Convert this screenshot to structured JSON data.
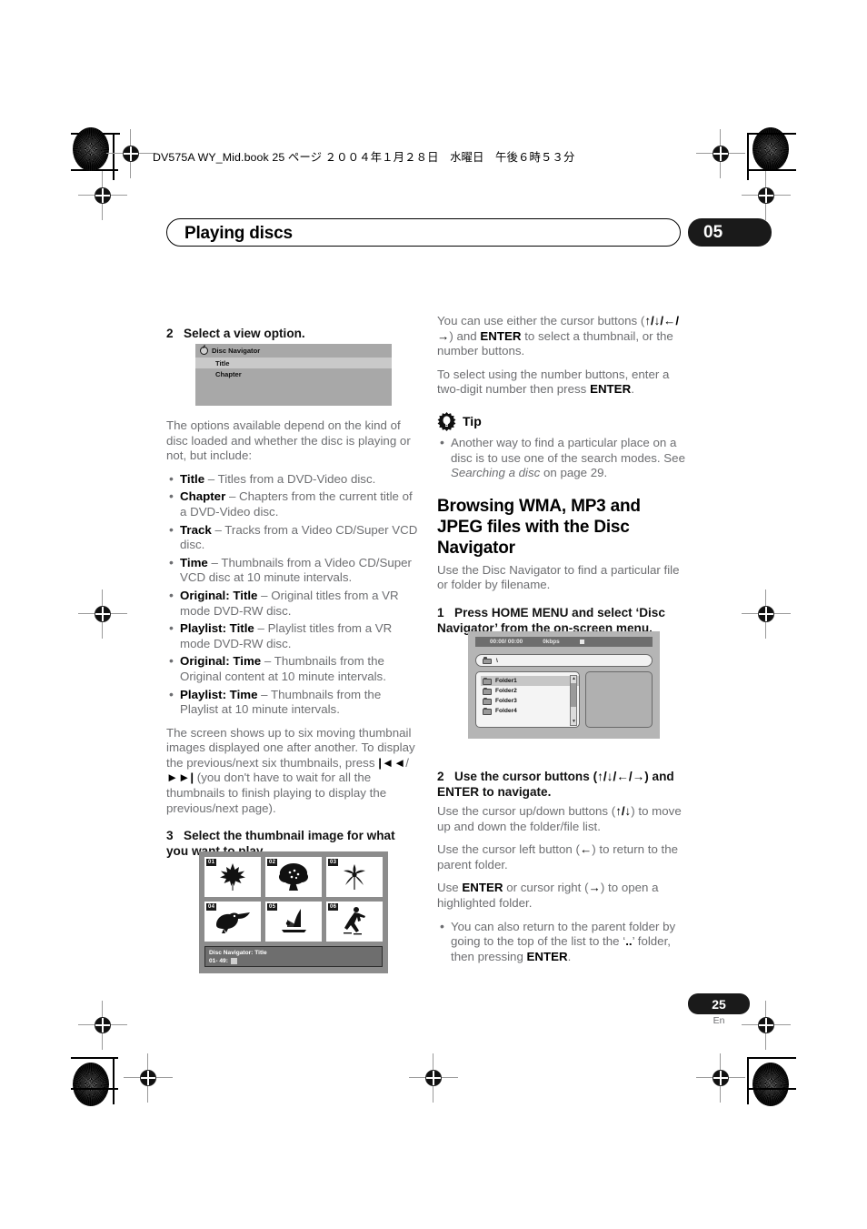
{
  "print_header": {
    "text": "DV575A WY_Mid.book  25 ページ  ２００４年１月２８日　水曜日　午後６時５３分"
  },
  "chapter": {
    "title": "Playing discs",
    "number": "05"
  },
  "left_column": {
    "step2": {
      "num": "2",
      "text": "Select a view option."
    },
    "fig_menu": {
      "header": "Disc Navigator",
      "rows": [
        "Title",
        "Chapter"
      ],
      "selected_index": 0
    },
    "intro_para": "The options available depend on the kind of disc loaded and whether the disc is playing or not, but include:",
    "bullets": [
      {
        "term": "Title",
        "desc": " – Titles from a DVD-Video disc."
      },
      {
        "term": "Chapter",
        "desc": " – Chapters from the current title of a DVD-Video disc."
      },
      {
        "term": "Track",
        "desc": " – Tracks from a Video CD/Super VCD disc."
      },
      {
        "term": "Time",
        "desc": " – Thumbnails from a Video CD/Super VCD disc at 10 minute intervals."
      },
      {
        "term": "Original: Title",
        "desc": " – Original titles from a VR mode DVD-RW disc."
      },
      {
        "term": "Playlist: Title",
        "desc": " – Playlist titles from a VR mode DVD-RW disc."
      },
      {
        "term": "Original: Time",
        "desc": " – Thumbnails from the Original content at 10 minute intervals."
      },
      {
        "term": "Playlist: Time",
        "desc": " – Thumbnails from the Playlist at 10 minute intervals."
      }
    ],
    "thumbs_para_a": "The screen shows up to six moving thumbnail images displayed one after another. To display the previous/next six thumbnails, press ",
    "thumbs_para_prev_glyph": "|◄◄",
    "thumbs_para_slash": "/",
    "thumbs_para_next_glyph": "►►|",
    "thumbs_para_b": " (you don't have to wait for all the thumbnails to finish playing to display the previous/next page).",
    "step3": {
      "num": "3",
      "text": "Select the thumbnail image for what you want to play."
    },
    "fig_thumbs": {
      "items": [
        {
          "badge": "01",
          "icon": "maple-leaf-icon"
        },
        {
          "badge": "02",
          "icon": "tree-icon"
        },
        {
          "badge": "03",
          "icon": "flower-icon"
        },
        {
          "badge": "04",
          "icon": "toucan-icon"
        },
        {
          "badge": "05",
          "icon": "windsurfer-icon"
        },
        {
          "badge": "06",
          "icon": "skater-icon"
        }
      ],
      "status_line1": "Disc Navigator: Title",
      "status_line2": "01- 49:"
    }
  },
  "right_column": {
    "cursor_para_a": "You can use either the cursor buttons (",
    "cursor_glyphs_1": "↑/↓/",
    "cursor_glyphs_2": "←/→",
    "cursor_para_b": ") and ",
    "enter_label": "ENTER",
    "cursor_para_c": " to select a thumbnail, or the number buttons.",
    "number_para_a": "To select using the number buttons, enter a two-digit number then press ",
    "number_para_b": ".",
    "tip": {
      "icon": "gear-lightbulb-icon",
      "title": "Tip",
      "bullet_a": "Another way to find a particular place on a disc is to use one of the search modes. See ",
      "bullet_italic": "Searching a disc",
      "bullet_b": " on page 29."
    },
    "section_heading": "Browsing WMA, MP3 and JPEG files with the Disc Navigator",
    "section_intro": "Use the Disc Navigator to find a particular file or folder by filename.",
    "step1": {
      "num": "1",
      "text": "Press HOME MENU and select ‘Disc Navigator’ from the on-screen menu."
    },
    "fig_folder": {
      "time": "00:00/ 00:00",
      "bitrate": "0kbps",
      "stop_icon": "stop-square-icon",
      "path": "\\",
      "items": [
        "Folder1",
        "Folder2",
        "Folder3",
        "Folder4"
      ],
      "selected_index": 0
    },
    "step2": {
      "num": "2",
      "text_a": "Use the cursor buttons (",
      "glyphs": "↑/↓/←/→",
      "text_b": ") and ENTER to navigate."
    },
    "nav_para1_a": "Use the cursor up/down buttons (",
    "nav_para1_glyphs": "↑/↓",
    "nav_para1_b": ") to move up and down the folder/file list.",
    "nav_para2_a": "Use the cursor left button (",
    "nav_para2_glyph": "←",
    "nav_para2_b": ") to return to the parent folder.",
    "nav_para3_a": "Use ",
    "nav_para3_enter": "ENTER",
    "nav_para3_b": " or cursor right (",
    "nav_para3_glyph": "→",
    "nav_para3_c": ") to open a highlighted folder.",
    "nav_bullet_a": "You can also return to the parent folder by going to the top of the list to the ‘",
    "nav_bullet_dots": "..",
    "nav_bullet_b": "’ folder, then pressing ",
    "nav_bullet_enter": "ENTER",
    "nav_bullet_c": "."
  },
  "footer": {
    "page": "25",
    "language": "En"
  },
  "colors": {
    "text_gray": "#6d6e71",
    "heading_black": "#000000",
    "badge_black": "#1a1a1a",
    "screen_gray": "#a8a8a8"
  }
}
